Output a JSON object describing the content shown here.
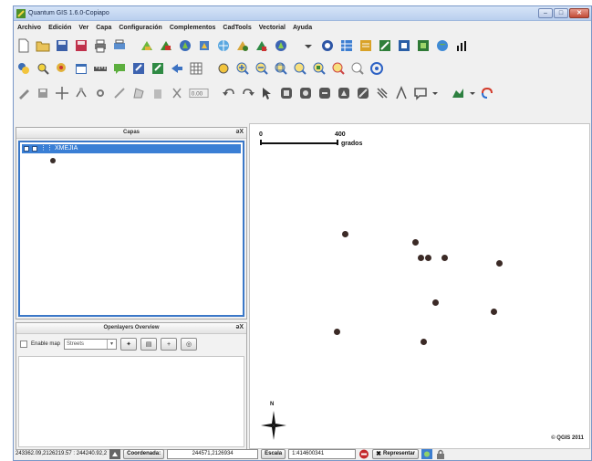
{
  "window": {
    "title": "Quantum GIS 1.6.0-Copiapo"
  },
  "menu": [
    "Archivo",
    "Edición",
    "Ver",
    "Capa",
    "Configuración",
    "Complementos",
    "CadTools",
    "Vectorial",
    "Ayuda"
  ],
  "layers_panel": {
    "title": "Capas",
    "controls": "əX",
    "layer_name": "XMEJIA"
  },
  "openlayers_panel": {
    "title": "Openlayers Overview",
    "controls": "əX",
    "enable_label": "Enable map",
    "layer_select": "Streets",
    "btn_glyph_1": "✦",
    "btn_glyph_2": "▤",
    "btn_glyph_3": "+",
    "btn_glyph_4": "◎"
  },
  "map": {
    "scale_start": "0",
    "scale_end": "400",
    "scale_unit": "grados",
    "north_label": "N",
    "copyright": "© QGIS 2011",
    "points": [
      {
        "x": 0.281,
        "y": 0.339
      },
      {
        "x": 0.489,
        "y": 0.364
      },
      {
        "x": 0.504,
        "y": 0.412
      },
      {
        "x": 0.526,
        "y": 0.412
      },
      {
        "x": 0.574,
        "y": 0.412
      },
      {
        "x": 0.734,
        "y": 0.43
      },
      {
        "x": 0.548,
        "y": 0.552
      },
      {
        "x": 0.72,
        "y": 0.58
      },
      {
        "x": 0.257,
        "y": 0.641
      },
      {
        "x": 0.512,
        "y": 0.672
      }
    ]
  },
  "status": {
    "coords_text": "243362.09,2126219.57 : 244240.92,2",
    "coord_label": "Coordenada:",
    "coord_value": "244571,2126934",
    "scale_label": "Escala",
    "scale_value": "1:414600341",
    "render_label": "Representar"
  },
  "colors": {
    "selection": "#3a7fd5",
    "point": "#3b2a26"
  }
}
